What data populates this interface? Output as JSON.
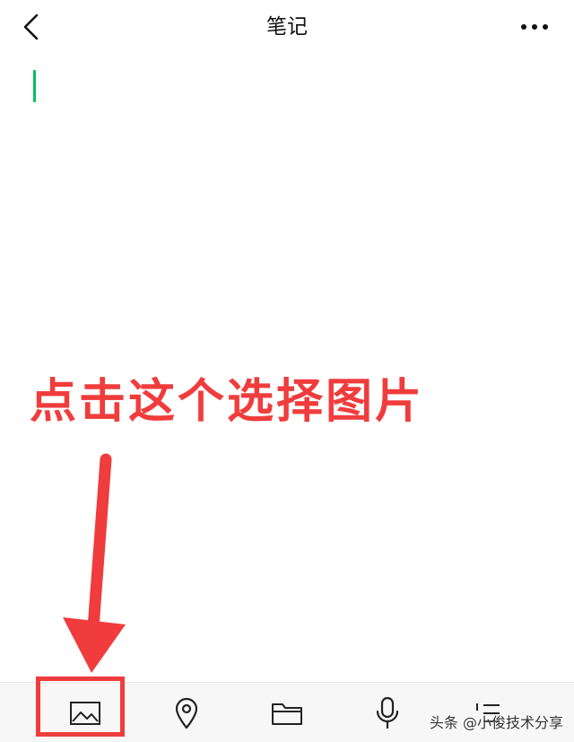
{
  "header": {
    "title": "笔记",
    "back_icon": "chevron-left-icon",
    "more_icon": "more-horizontal-icon"
  },
  "editor": {
    "cursor_color": "#07c160"
  },
  "annotation": {
    "text": "点击这个选择图片",
    "color": "#f03c3c"
  },
  "toolbar": {
    "items": [
      {
        "name": "image",
        "icon": "image-icon"
      },
      {
        "name": "location",
        "icon": "location-pin-icon"
      },
      {
        "name": "folder",
        "icon": "folder-icon"
      },
      {
        "name": "voice",
        "icon": "microphone-icon"
      },
      {
        "name": "list",
        "icon": "numbered-list-icon"
      }
    ]
  },
  "watermark": {
    "text": "头条 @小俊技术分享"
  }
}
